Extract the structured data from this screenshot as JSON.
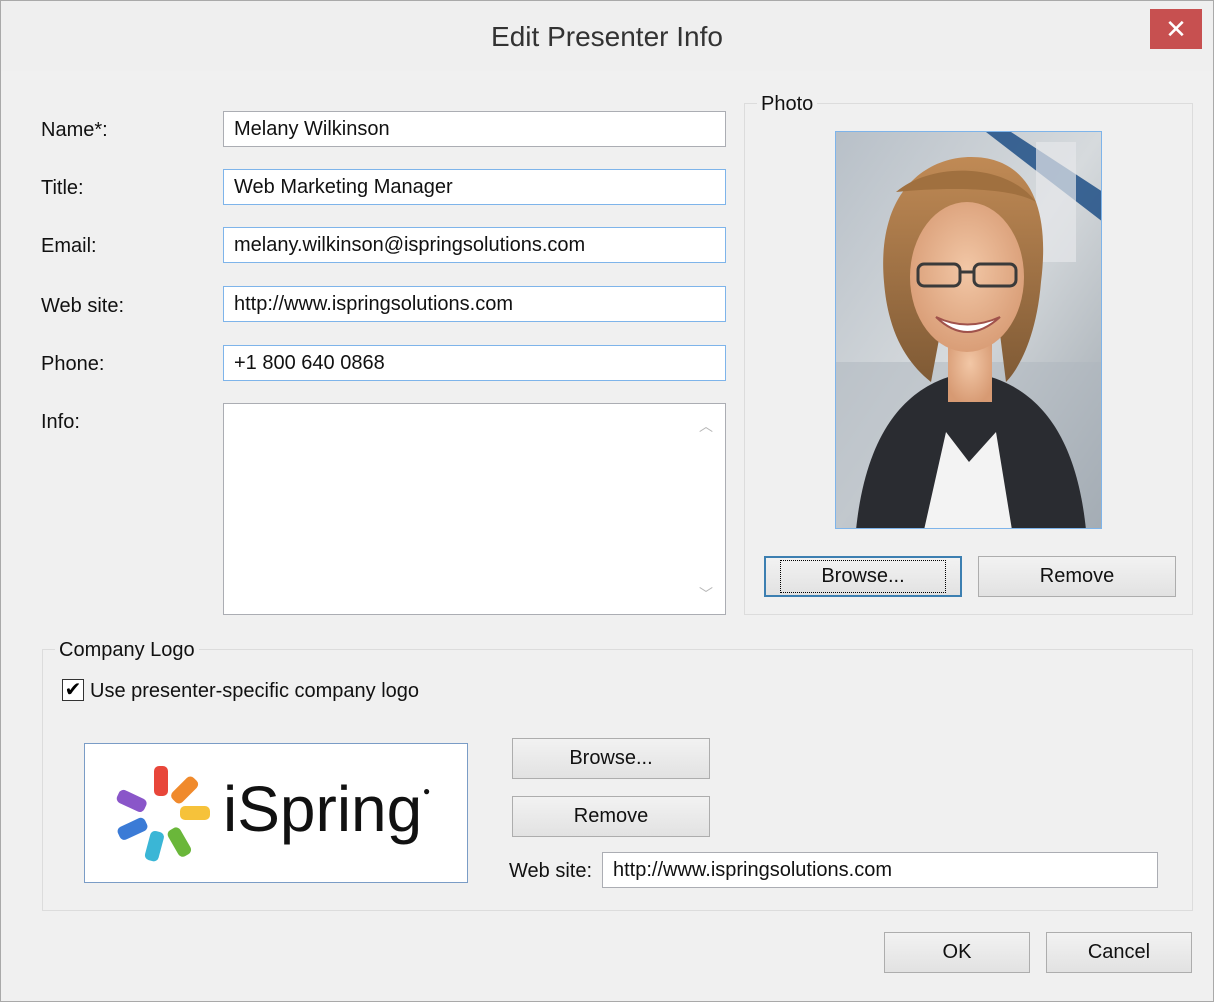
{
  "window": {
    "title": "Edit Presenter Info",
    "close_symbol": "✕"
  },
  "form": {
    "name_label": "Name*:",
    "name_value": "Melany Wilkinson",
    "title_label": "Title:",
    "title_value": "Web Marketing Manager",
    "email_label": "Email:",
    "email_value": "melany.wilkinson@ispringsolutions.com",
    "website_label": "Web site:",
    "website_value": "http://www.ispringsolutions.com",
    "phone_label": "Phone:",
    "phone_value": "+1 800 640 0868",
    "info_label": "Info:",
    "info_value": ""
  },
  "photo": {
    "legend": "Photo",
    "browse_label": "Browse...",
    "remove_label": "Remove"
  },
  "logo": {
    "legend": "Company Logo",
    "checkbox_label": "Use presenter-specific company logo",
    "checkbox_checked": true,
    "logo_text": "iSpring",
    "browse_label": "Browse...",
    "remove_label": "Remove",
    "website_label": "Web site:",
    "website_value": "http://www.ispringsolutions.com"
  },
  "footer": {
    "ok_label": "OK",
    "cancel_label": "Cancel"
  },
  "colors": {
    "close_button": "#c75050",
    "focus_border": "#7eb4ea",
    "default_button_border": "#3c7fb1"
  }
}
